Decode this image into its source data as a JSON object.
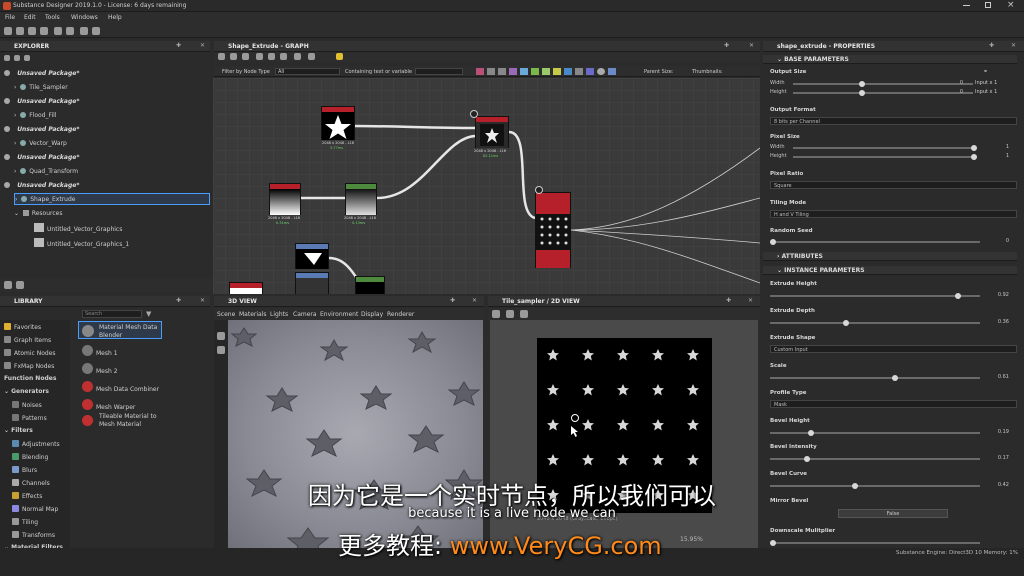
{
  "titlebar": {
    "title": "Substance Designer 2019.1.0 - License: 6 days remaining"
  },
  "menu": [
    "File",
    "Edit",
    "Tools",
    "Windows",
    "Help"
  ],
  "explorer": {
    "title": "EXPLORER",
    "items": [
      {
        "type": "pkg",
        "label": "Unsaved Package*"
      },
      {
        "type": "graph",
        "label": "Tile_Sampler"
      },
      {
        "type": "pkg",
        "label": "Unsaved Package*"
      },
      {
        "type": "graph",
        "label": "Flood_Fill"
      },
      {
        "type": "pkg",
        "label": "Unsaved Package*"
      },
      {
        "type": "graph",
        "label": "Vector_Warp"
      },
      {
        "type": "pkg",
        "label": "Unsaved Package*"
      },
      {
        "type": "graph",
        "label": "Quad_Transform"
      },
      {
        "type": "pkg",
        "label": "Unsaved Package*"
      },
      {
        "type": "graph",
        "label": "Shape_Extrude"
      },
      {
        "type": "folder",
        "label": "Resources"
      },
      {
        "type": "res",
        "label": "Untitled_Vector_Graphics"
      },
      {
        "type": "res",
        "label": "Untitled_Vector_Graphics_1"
      }
    ]
  },
  "graph": {
    "title": "Shape_Extrude - GRAPH",
    "filter_label": "Filter by Node Type",
    "filter_value": "All",
    "contain_label": "Containing text or variable",
    "parent_size": "Parent Size:",
    "thumbnails": "Thumbnails:",
    "nodes": {
      "star": "Star",
      "tile": "Tile Generator",
      "gradient": "Gradient Linear 1",
      "curve": "Curve",
      "tilesampler": "Tile Sampler",
      "shape": "Shape",
      "transform": "Transformation 2D"
    },
    "node_res": "2048 x 2048 - L16",
    "node_time_a": "5.77ms",
    "node_time_b": "0.31ms",
    "node_time_c": "82.11ms",
    "node_time_d": "0.13ms"
  },
  "library": {
    "title": "LIBRARY",
    "search_placeholder": "Search",
    "categories": [
      "Favorites",
      "Graph Items",
      "Atomic Nodes",
      "FxMap Nodes",
      "Function Nodes",
      "Generators",
      "Noises",
      "Patterns",
      "Filters",
      "Adjustments",
      "Blending",
      "Blurs",
      "Channels",
      "Effects",
      "Normal Map",
      "Tiling",
      "Transforms",
      "Material Filters"
    ],
    "entries": [
      "Material Mesh Data Blender",
      "Mesh 1",
      "Mesh 2",
      "Mesh Data Combiner",
      "Mesh Warper",
      "Tileable Material to Mesh Material"
    ]
  },
  "view3d": {
    "title": "3D VIEW",
    "menu": [
      "Scene",
      "Materials",
      "Lights",
      "Camera",
      "Environment",
      "Display",
      "Renderer"
    ]
  },
  "view2d": {
    "title": "Tile_sampler / 2D VIEW",
    "zoom": "15.95%",
    "info": "2048 x 2048 (Grayscale, 16bpc)"
  },
  "props": {
    "title": "shape_extrude - PROPERTIES",
    "sections": {
      "base": "BASE PARAMETERS",
      "attr": "ATTRIBUTES",
      "inst": "INSTANCE PARAMETERS"
    },
    "output_size": "Output Size",
    "width": "Width",
    "height": "Height",
    "input_x1": "Input x 1",
    "zero": "0",
    "output_format": "Output Format",
    "format_val": "8 bits per Channel",
    "pixel_size": "Pixel Size",
    "one": "1",
    "pixel_ratio": "Pixel Ratio",
    "ratio_val": "Square",
    "tiling_mode": "Tiling Mode",
    "tiling_val": "H and V Tiling",
    "random_seed": "Random Seed",
    "extrude_height": "Extrude Height",
    "extrude_height_v": "0.92",
    "extrude_depth": "Extrude Depth",
    "extrude_depth_v": "0.36",
    "extrude_shape": "Extrude Shape",
    "extrude_shape_v": "Custom Input",
    "scale": "Scale",
    "scale_v": "0.61",
    "profile_type": "Profile Type",
    "profile_val": "Mask",
    "bevel_height": "Bevel Height",
    "bevel_height_v": "0.19",
    "bevel_intensity": "Bevel Intensity",
    "bevel_intensity_v": "0.17",
    "bevel_curve": "Bevel Curve",
    "bevel_curve_v": "0.42",
    "mirror_bevel": "Mirror Bevel",
    "mirror_val": "False",
    "downscale": "Downscale Mulitplier"
  },
  "status": {
    "engine": "Substance Engine: Direct3D 10  Memory: 1%"
  },
  "subtitles": {
    "cn": "因为它是一个实时节点，所以我们可以",
    "en": "because it is a live node we can",
    "wm_prefix": "更多教程:",
    "wm_site": "www.VeryCG.com"
  },
  "colors": {
    "accent": "#4a9cff",
    "node_red": "#b5202a",
    "node_green": "#4d8a3e",
    "watermark": "#ff8a1a"
  }
}
